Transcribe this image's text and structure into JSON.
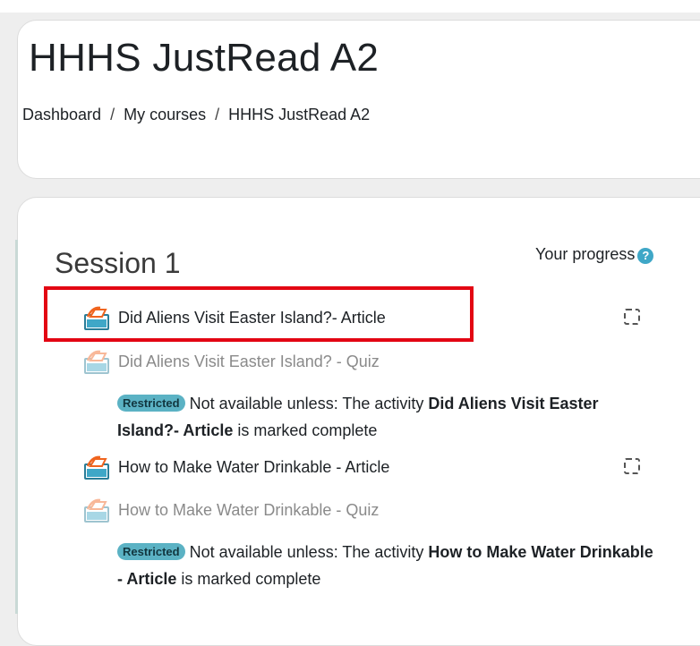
{
  "header": {
    "title": "HHHS JustRead A2",
    "breadcrumb": [
      "Dashboard",
      "My courses",
      "HHHS JustRead A2"
    ]
  },
  "section": {
    "title": "Session 1",
    "progress_label": "Your progress",
    "help_glyph": "?"
  },
  "activities": [
    {
      "name": "Did Aliens Visit Easter Island?- Article",
      "available": true,
      "icon": "lesson-icon"
    },
    {
      "name": "Did Aliens Visit Easter Island? - Quiz",
      "available": false,
      "icon": "lesson-icon"
    },
    {
      "name": "How to Make Water Drinkable - Article",
      "available": true,
      "icon": "lesson-icon"
    },
    {
      "name": "How to Make Water Drinkable - Quiz",
      "available": false,
      "icon": "lesson-icon"
    }
  ],
  "restrictions": [
    {
      "badge": "Restricted",
      "prefix": "Not available unless: The activity",
      "activity": "Did Aliens Visit Easter Island?- Article",
      "suffix": "is marked complete"
    },
    {
      "badge": "Restricted",
      "prefix": "Not available unless: The activity",
      "activity": "How to Make Water Drinkable - Article",
      "suffix": "is marked complete"
    }
  ],
  "colors": {
    "highlight": "#e30613",
    "badge": "#5bb2c4",
    "icon_orange": "#f0641e",
    "icon_blue": "#3fa7c7"
  }
}
